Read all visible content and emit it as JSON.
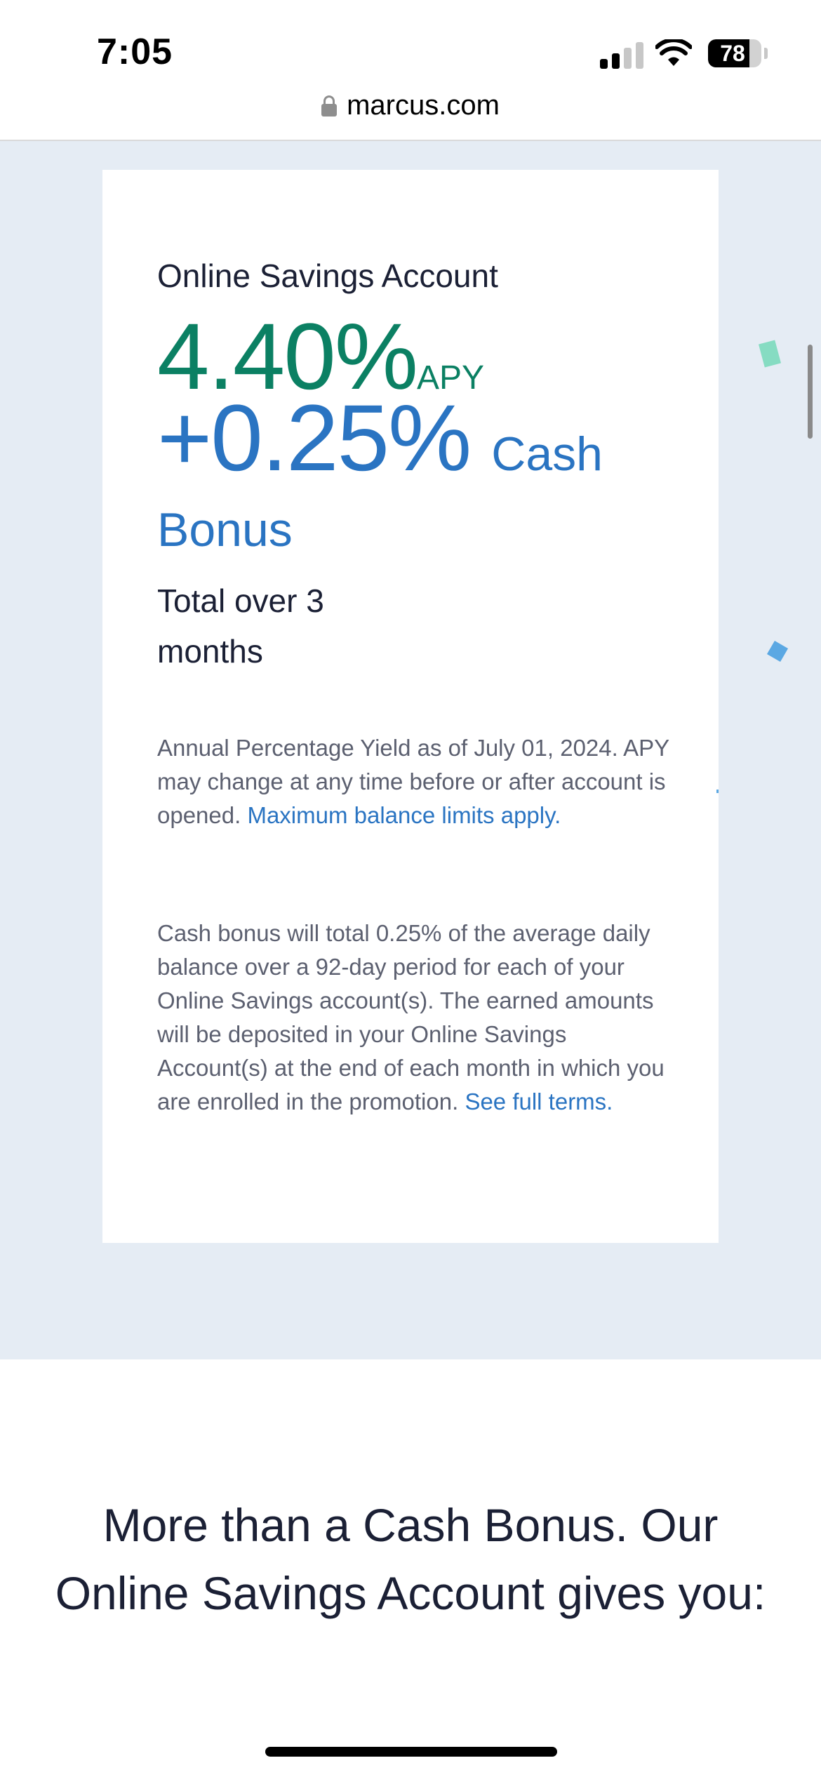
{
  "status_bar": {
    "time": "7:05",
    "battery": "78",
    "battery_level": 0.78
  },
  "browser": {
    "url": "marcus.com"
  },
  "offer_card": {
    "product_name": "Online Savings Account",
    "apy_rate": "4.40%",
    "apy_unit": "APY",
    "bonus_rate": "+0.25%",
    "bonus_word": "Cash",
    "bonus_word2": "Bonus",
    "total_line1": "Total over 3",
    "total_line2": "months",
    "disclosure_apy": "Annual Percentage Yield as of July 01, 2024. APY may change at any time before or after account is opened.",
    "disclosure_apy_link": "Maximum balance limits apply.",
    "disclosure_bonus": "Cash bonus will total 0.25% of the average daily balance over a 92-day period for each of your Online Savings account(s). The earned amounts will be deposited in your Online Savings Account(s) at the end of each month in which you are enrolled in the promotion.",
    "disclosure_bonus_link": "See full terms."
  },
  "section": {
    "headline": "More than a Cash Bonus. Our Online Savings Account gives you:"
  },
  "colors": {
    "apy_green": "#0b8063",
    "bonus_blue": "#2a74c2",
    "hero_background": "#e5ecf4",
    "text_dark": "#1b2035",
    "text_muted": "#5c6070"
  }
}
